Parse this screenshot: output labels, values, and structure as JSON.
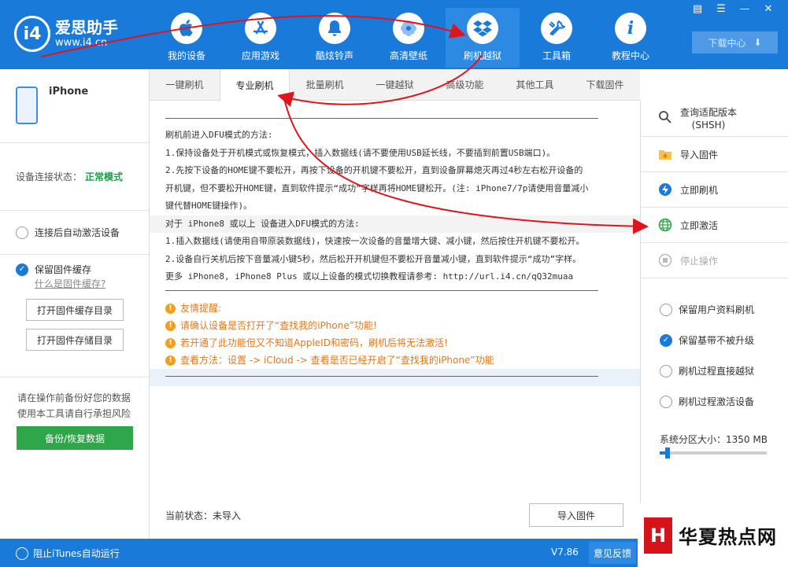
{
  "app": {
    "logo_mark": "i4",
    "logo_name": "爱思助手",
    "logo_url": "www.i4.cn",
    "accent": "#1a7ad9"
  },
  "nav": [
    {
      "label": "我的设备",
      "icon": "apple-icon"
    },
    {
      "label": "应用游戏",
      "icon": "app-store-icon"
    },
    {
      "label": "酷炫铃声",
      "icon": "bell-icon"
    },
    {
      "label": "高清壁纸",
      "icon": "flower-icon"
    },
    {
      "label": "刷机越狱",
      "icon": "dropbox-icon"
    },
    {
      "label": "工具箱",
      "icon": "tools-icon"
    },
    {
      "label": "教程中心",
      "icon": "info-icon"
    }
  ],
  "window": {
    "download_center": "下载中心"
  },
  "sidebar": {
    "device_name": "iPhone",
    "conn_label": "设备连接状态：",
    "conn_value": "正常模式",
    "auto_activate": "连接后自动激活设备",
    "keep_fw": "保留固件缓存",
    "fw_link": "什么是固件缓存?",
    "open_cache_dir": "打开固件缓存目录",
    "open_store_dir": "打开固件存储目录",
    "risk_1": "请在操作前备份好您的数据",
    "risk_2": "使用本工具请自行承担风险",
    "backup": "备份/恢复数据"
  },
  "tabs": [
    "一键刷机",
    "专业刷机",
    "批量刷机",
    "一键越狱",
    "高级功能",
    "其他工具",
    "下载固件"
  ],
  "content": {
    "lines": [
      "刷机前进入DFU模式的方法:",
      "1.保持设备处于开机模式或恢复模式，插入数据线(请不要使用USB延长线，不要插到前置USB端口)。",
      "2.先按下设备的HOME键不要松开，再按下设备的开机键不要松开，直到设备屏幕熄灭再过4秒左右松开设备的",
      "开机键，但不要松开HOME键，直到软件提示“成功”字样再将HOME键松开。(注: iPhone7/7p请使用音量减小",
      "键代替HOME键操作)。",
      "对于 iPhone8 或以上 设备进入DFU模式的方法:",
      "1.插入数据线(请使用自带原装数据线)，快速按一次设备的音量增大键、减小键，然后按住开机键不要松开。",
      "2.设备自行关机后按下音量减小键5秒，然后松开开机键但不要松开音量减小键，直到软件提示“成功”字样。",
      "更多 iPhone8, iPhone8 Plus 或以上设备的模式切换教程请参考: http://url.i4.cn/qQ32muaa"
    ],
    "tips": [
      "友情提醒:",
      "请确认设备是否打开了“查找我的iPhone”功能!",
      "若开通了此功能但又不知道AppleID和密码，刷机后将无法激活!",
      "查看方法：设置 -> iCloud -> 查看是否已经开启了“查找我的iPhone”功能"
    ],
    "status_label": "当前状态：",
    "status_value": "未导入",
    "import_btn": "导入固件"
  },
  "right": {
    "query_shsh_1": "查询适配版本",
    "query_shsh_2": "(SHSH)",
    "import_fw": "导入固件",
    "flash_now": "立即刷机",
    "activate_now": "立即激活",
    "stop": "停止操作",
    "keep_user_data": "保留用户资料刷机",
    "keep_baseband": "保留基带不被升级",
    "jailbreak": "刷机过程直接越狱",
    "activate": "刷机过程激活设备",
    "sys_size_label": "系统分区大小：",
    "sys_size_value": "1350 MB",
    "sys_size_fraction": 0.07
  },
  "footer": {
    "itunes": "阻止iTunes自动运行",
    "version": "V7.86",
    "feedback": "意见反馈"
  },
  "watermark": {
    "logo": "H",
    "text": "华夏热点网"
  }
}
